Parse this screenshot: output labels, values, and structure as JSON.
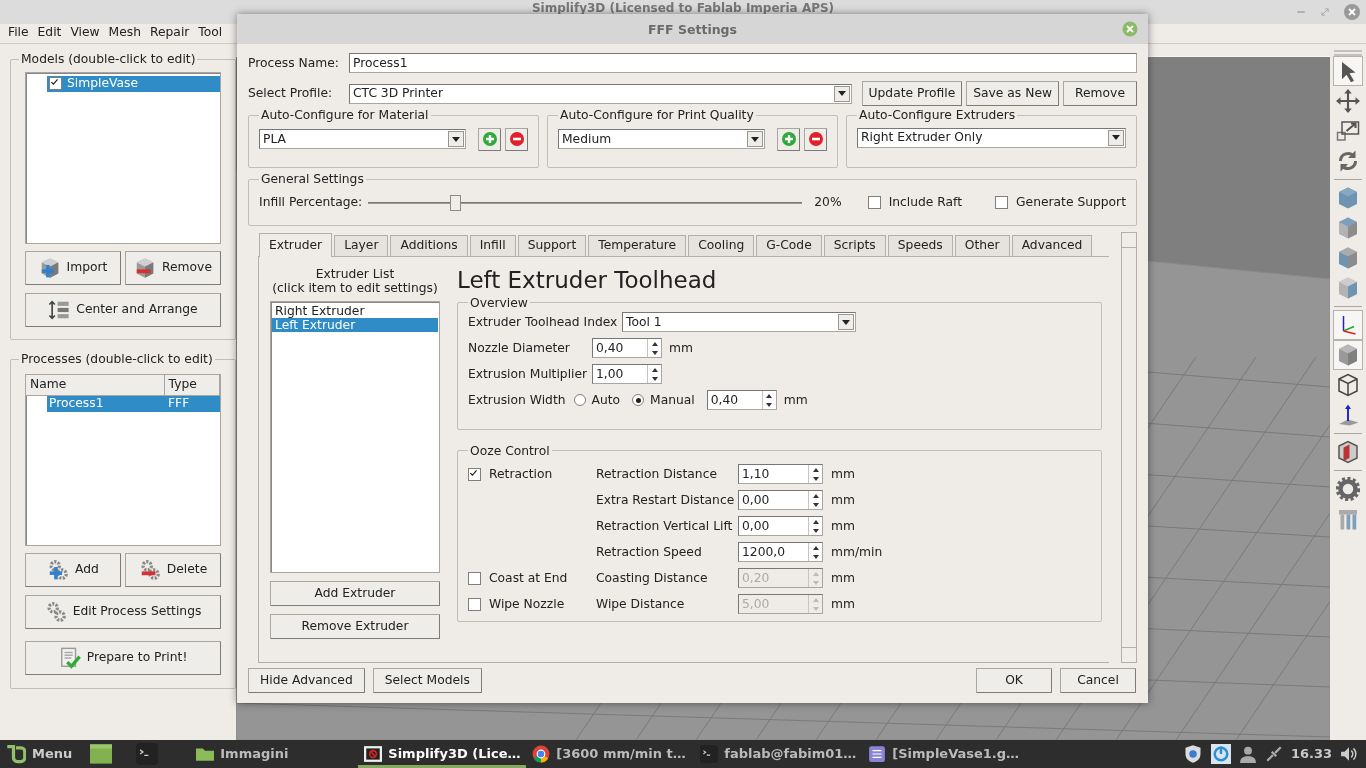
{
  "window": {
    "title": "Simplify3D (Licensed to Fablab Imperia APS)"
  },
  "menu": [
    "File",
    "Edit",
    "View",
    "Mesh",
    "Repair",
    "Tool"
  ],
  "models": {
    "title": "Models (double-click to edit)",
    "items": [
      {
        "label": "SimpleVase",
        "checked": true,
        "selected": true
      }
    ],
    "buttons": [
      {
        "kind": "import",
        "label": "Import"
      },
      {
        "kind": "remove",
        "label": "Remove"
      },
      {
        "kind": "arrange",
        "label": "Center and Arrange"
      }
    ]
  },
  "processes": {
    "title": "Processes (double-click to edit)",
    "columns": [
      "Name",
      "Type"
    ],
    "rows": [
      {
        "cells": [
          "Process1",
          "FFF"
        ],
        "selected": true
      }
    ],
    "buttons": [
      {
        "kind": "add",
        "label": "Add"
      },
      {
        "kind": "delete",
        "label": "Delete"
      },
      {
        "kind": "edit",
        "label": "Edit Process Settings"
      },
      {
        "kind": "prepare",
        "label": "Prepare to Print!"
      }
    ]
  },
  "toolbar": [
    [
      {
        "kind": "select",
        "selected": true
      },
      {
        "kind": "move",
        "selected": false
      },
      {
        "kind": "scale",
        "selected": false
      },
      {
        "kind": "rotate",
        "selected": false
      }
    ],
    [
      {
        "kind": "view-iso",
        "selected": false
      },
      {
        "kind": "view-top",
        "selected": false
      },
      {
        "kind": "view-front",
        "selected": false
      },
      {
        "kind": "view-side",
        "selected": false
      }
    ],
    [
      {
        "kind": "axes",
        "selected": true
      },
      {
        "kind": "solid",
        "selected": true
      },
      {
        "kind": "wireframe",
        "selected": false
      },
      {
        "kind": "normals",
        "selected": false
      }
    ],
    [
      {
        "kind": "cross-section",
        "selected": false
      }
    ],
    [
      {
        "kind": "settings",
        "selected": false
      },
      {
        "kind": "supports",
        "selected": false
      }
    ]
  ],
  "dialog": {
    "title": "FFF Settings",
    "process_name_label": "Process Name:",
    "process_name": "Process1",
    "profile_label": "Select Profile:",
    "profile": "CTC 3D Printer",
    "profile_buttons": [
      "Update Profile",
      "Save as New",
      "Remove"
    ],
    "autoconfig": [
      {
        "title": "Auto-Configure for Material",
        "value": "PLA",
        "kind": "editable"
      },
      {
        "title": "Auto-Configure for Print Quality",
        "value": "Medium",
        "kind": "editable"
      },
      {
        "title": "Auto-Configure Extruders",
        "value": "Right Extruder Only",
        "kind": "plain"
      }
    ],
    "general": {
      "title": "General Settings",
      "infill_label": "Infill Percentage:",
      "level": 0.2,
      "reading": "20%",
      "checkboxes": [
        {
          "label": "Include Raft",
          "checked": false
        },
        {
          "label": "Generate Support",
          "checked": false
        }
      ]
    },
    "tabs": [
      {
        "label": "Extruder",
        "selected": true
      },
      {
        "label": "Layer",
        "selected": false
      },
      {
        "label": "Additions",
        "selected": false
      },
      {
        "label": "Infill",
        "selected": false
      },
      {
        "label": "Support",
        "selected": false
      },
      {
        "label": "Temperature",
        "selected": false
      },
      {
        "label": "Cooling",
        "selected": false
      },
      {
        "label": "G-Code",
        "selected": false
      },
      {
        "label": "Scripts",
        "selected": false
      },
      {
        "label": "Speeds",
        "selected": false
      },
      {
        "label": "Other",
        "selected": false
      },
      {
        "label": "Advanced",
        "selected": false
      }
    ],
    "extruder_list": {
      "title": "Extruder List",
      "subtitle": "(click item to edit settings)",
      "items": [
        {
          "label": "Right Extruder",
          "selected": false
        },
        {
          "label": "Left Extruder",
          "selected": true
        }
      ],
      "buttons": [
        "Add Extruder",
        "Remove Extruder"
      ]
    },
    "heading": "Left Extruder Toolhead",
    "overview": {
      "title": "Overview",
      "fields": [
        {
          "kind": "select",
          "label": "Extruder Toolhead Index",
          "value": "Tool 1"
        },
        {
          "kind": "spin",
          "label": "Nozzle Diameter",
          "value": "0,40",
          "unit": "mm"
        },
        {
          "kind": "spin",
          "label": "Extrusion Multiplier",
          "value": "1,00"
        },
        {
          "kind": "radio",
          "label": "Extrusion Width",
          "options": [
            {
              "label": "Auto",
              "selected": false
            },
            {
              "label": "Manual",
              "selected": true
            }
          ],
          "value": "0,40",
          "unit": "mm"
        }
      ]
    },
    "ooze": {
      "title": "Ooze Control",
      "rows": [
        {
          "check": {
            "label": "Retraction",
            "checked": true
          },
          "label": "Retraction Distance",
          "value": "1,10",
          "unit": "mm",
          "disabled": false
        },
        {
          "label": "Extra Restart Distance",
          "value": "0,00",
          "unit": "mm",
          "disabled": false
        },
        {
          "label": "Retraction Vertical Lift",
          "value": "0,00",
          "unit": "mm",
          "disabled": false
        },
        {
          "label": "Retraction Speed",
          "value": "1200,0",
          "unit": "mm/min",
          "disabled": false
        },
        {
          "check": {
            "label": "Coast at End",
            "checked": false
          },
          "label": "Coasting Distance",
          "value": "0,20",
          "unit": "mm",
          "disabled": true
        },
        {
          "check": {
            "label": "Wipe Nozzle",
            "checked": false
          },
          "label": "Wipe Distance",
          "value": "5,00",
          "unit": "mm",
          "disabled": true
        }
      ]
    },
    "left_buttons": [
      "Hide Advanced",
      "Select Models"
    ],
    "right_buttons": [
      "OK",
      "Cancel"
    ]
  },
  "taskbar": {
    "menu": "Menu",
    "launchers": [
      {
        "kind": "files"
      },
      {
        "kind": "terminal"
      }
    ],
    "tasks": [
      {
        "kind": "folder",
        "label": "Immagini",
        "selected": false
      },
      {
        "kind": "app",
        "label": "Simplify3D (Lice…",
        "selected": true
      },
      {
        "kind": "browser",
        "label": "[3600 mm/min t…",
        "selected": false
      },
      {
        "kind": "terminal",
        "label": "fablab@fabim01…",
        "selected": false
      },
      {
        "kind": "editor",
        "label": "[SimpleVase1.g…",
        "selected": false
      }
    ],
    "clock": "16.33"
  }
}
